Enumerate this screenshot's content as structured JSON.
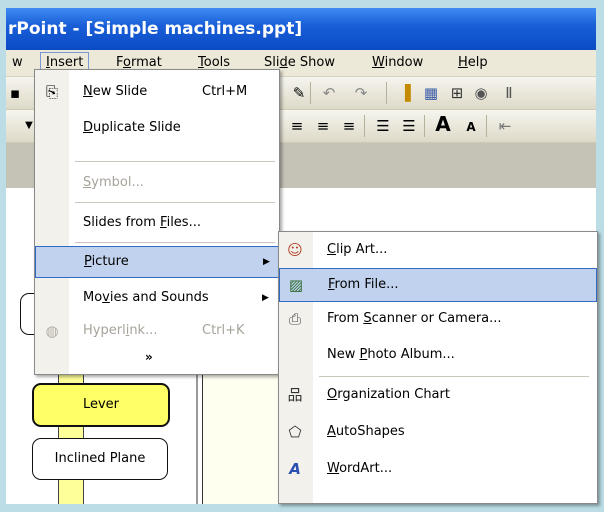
{
  "window": {
    "title": "rPoint - [Simple machines.ppt]"
  },
  "menubar": [
    "w",
    "Insert",
    "Format",
    "Tools",
    "Slide Show",
    "Window",
    "Help"
  ],
  "insert_menu": {
    "items": [
      {
        "label": "New Slide",
        "shortcut": "Ctrl+M",
        "icon": "new-slide-icon",
        "enabled": true
      },
      {
        "label": "Duplicate Slide",
        "shortcut": "",
        "enabled": true
      },
      {
        "label": "Symbol...",
        "shortcut": "",
        "enabled": false
      },
      {
        "label": "Slides from Files...",
        "shortcut": "",
        "enabled": true
      },
      {
        "label": "Picture",
        "shortcut": "",
        "submenu": true,
        "highlighted": true
      },
      {
        "label": "Movies and Sounds",
        "shortcut": "",
        "submenu": true
      },
      {
        "label": "Hyperlink...",
        "shortcut": "Ctrl+K",
        "icon": "globe-link-icon",
        "enabled": false
      }
    ],
    "expand_icon": "double-chevron-down-icon"
  },
  "picture_submenu": {
    "items": [
      {
        "label": "Clip Art...",
        "icon": "clip-art-icon"
      },
      {
        "label": "From File...",
        "icon": "picture-file-icon",
        "highlighted": true
      },
      {
        "label": "From Scanner or Camera...",
        "icon": "scanner-icon"
      },
      {
        "label": "New Photo Album...",
        "icon": ""
      },
      {
        "label": "Organization Chart",
        "icon": "org-chart-icon"
      },
      {
        "label": "AutoShapes",
        "icon": "autoshapes-icon"
      },
      {
        "label": "WordArt...",
        "icon": "wordart-icon"
      }
    ]
  },
  "outline": {
    "nodes": [
      "Lever",
      "Inclined Plane"
    ]
  },
  "colors": {
    "titlebar": "#0a4bc4",
    "highlight": "#c1d2ee",
    "highlight_border": "#316ac5",
    "lever_fill": "#ffff66"
  }
}
